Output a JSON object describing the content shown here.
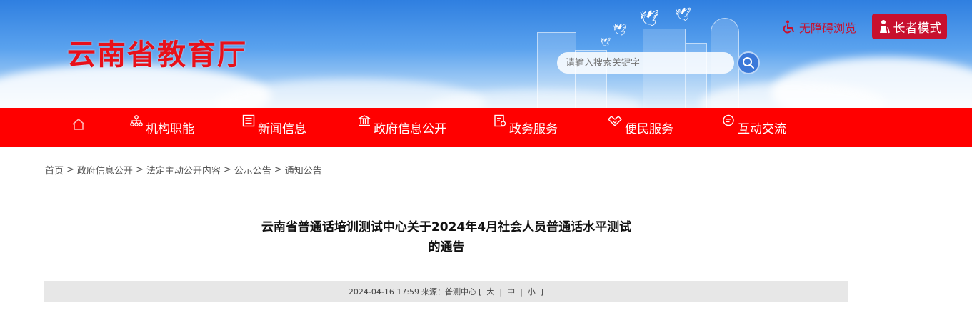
{
  "header": {
    "site_title": "云南省教育厅",
    "search_placeholder": "请输入搜索关键字",
    "accessibility_label": "无障碍浏览",
    "elder_mode_label": "长者模式"
  },
  "nav": {
    "items": [
      {
        "label": "机构职能",
        "icon": "org-chart-icon"
      },
      {
        "label": "新闻信息",
        "icon": "newspaper-icon"
      },
      {
        "label": "政府信息公开",
        "icon": "government-building-icon"
      },
      {
        "label": "政务服务",
        "icon": "service-form-icon"
      },
      {
        "label": "便民服务",
        "icon": "handshake-icon"
      },
      {
        "label": "互动交流",
        "icon": "chat-icon"
      }
    ]
  },
  "breadcrumb": [
    "首页",
    "政府信息公开",
    "法定主动公开内容",
    "公示公告",
    "通知公告"
  ],
  "article": {
    "title_line1": "云南省普通话培训测试中心关于2024年4月社会人员普通话水平测试",
    "title_line2": "的通告",
    "meta_datetime": "2024-04-16 17:59",
    "meta_source": "来源：普测中心",
    "size_large": "大",
    "size_medium": "中",
    "size_small": "小"
  },
  "colors": {
    "nav_bg": "#ff0000",
    "title_red": "#e8101a",
    "accent_dark_red": "#c8102e"
  }
}
